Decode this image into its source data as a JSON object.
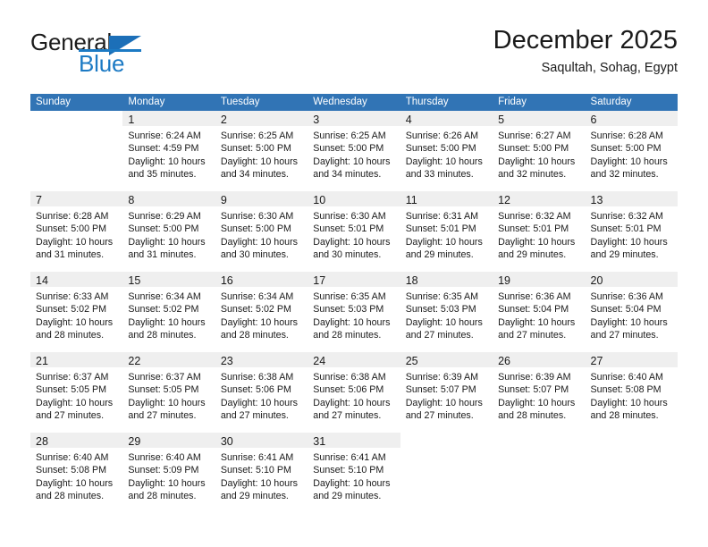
{
  "brand": {
    "name_part1": "General",
    "name_part2": "Blue",
    "logo_icon": "triangle-logo-icon",
    "accent_color": "#1c7ac4"
  },
  "header": {
    "title": "December 2025",
    "subtitle": "Saqultah, Sohag, Egypt"
  },
  "calendar": {
    "header_background": "#3174b5",
    "daynum_band_background": "#efefef",
    "week_rule_color": "#2a6db0",
    "weekdays": [
      "Sunday",
      "Monday",
      "Tuesday",
      "Wednesday",
      "Thursday",
      "Friday",
      "Saturday"
    ],
    "weeks": [
      [
        {
          "day": "",
          "lines": []
        },
        {
          "day": "1",
          "lines": [
            "Sunrise: 6:24 AM",
            "Sunset: 4:59 PM",
            "Daylight: 10 hours",
            "and 35 minutes."
          ]
        },
        {
          "day": "2",
          "lines": [
            "Sunrise: 6:25 AM",
            "Sunset: 5:00 PM",
            "Daylight: 10 hours",
            "and 34 minutes."
          ]
        },
        {
          "day": "3",
          "lines": [
            "Sunrise: 6:25 AM",
            "Sunset: 5:00 PM",
            "Daylight: 10 hours",
            "and 34 minutes."
          ]
        },
        {
          "day": "4",
          "lines": [
            "Sunrise: 6:26 AM",
            "Sunset: 5:00 PM",
            "Daylight: 10 hours",
            "and 33 minutes."
          ]
        },
        {
          "day": "5",
          "lines": [
            "Sunrise: 6:27 AM",
            "Sunset: 5:00 PM",
            "Daylight: 10 hours",
            "and 32 minutes."
          ]
        },
        {
          "day": "6",
          "lines": [
            "Sunrise: 6:28 AM",
            "Sunset: 5:00 PM",
            "Daylight: 10 hours",
            "and 32 minutes."
          ]
        }
      ],
      [
        {
          "day": "7",
          "lines": [
            "Sunrise: 6:28 AM",
            "Sunset: 5:00 PM",
            "Daylight: 10 hours",
            "and 31 minutes."
          ]
        },
        {
          "day": "8",
          "lines": [
            "Sunrise: 6:29 AM",
            "Sunset: 5:00 PM",
            "Daylight: 10 hours",
            "and 31 minutes."
          ]
        },
        {
          "day": "9",
          "lines": [
            "Sunrise: 6:30 AM",
            "Sunset: 5:00 PM",
            "Daylight: 10 hours",
            "and 30 minutes."
          ]
        },
        {
          "day": "10",
          "lines": [
            "Sunrise: 6:30 AM",
            "Sunset: 5:01 PM",
            "Daylight: 10 hours",
            "and 30 minutes."
          ]
        },
        {
          "day": "11",
          "lines": [
            "Sunrise: 6:31 AM",
            "Sunset: 5:01 PM",
            "Daylight: 10 hours",
            "and 29 minutes."
          ]
        },
        {
          "day": "12",
          "lines": [
            "Sunrise: 6:32 AM",
            "Sunset: 5:01 PM",
            "Daylight: 10 hours",
            "and 29 minutes."
          ]
        },
        {
          "day": "13",
          "lines": [
            "Sunrise: 6:32 AM",
            "Sunset: 5:01 PM",
            "Daylight: 10 hours",
            "and 29 minutes."
          ]
        }
      ],
      [
        {
          "day": "14",
          "lines": [
            "Sunrise: 6:33 AM",
            "Sunset: 5:02 PM",
            "Daylight: 10 hours",
            "and 28 minutes."
          ]
        },
        {
          "day": "15",
          "lines": [
            "Sunrise: 6:34 AM",
            "Sunset: 5:02 PM",
            "Daylight: 10 hours",
            "and 28 minutes."
          ]
        },
        {
          "day": "16",
          "lines": [
            "Sunrise: 6:34 AM",
            "Sunset: 5:02 PM",
            "Daylight: 10 hours",
            "and 28 minutes."
          ]
        },
        {
          "day": "17",
          "lines": [
            "Sunrise: 6:35 AM",
            "Sunset: 5:03 PM",
            "Daylight: 10 hours",
            "and 28 minutes."
          ]
        },
        {
          "day": "18",
          "lines": [
            "Sunrise: 6:35 AM",
            "Sunset: 5:03 PM",
            "Daylight: 10 hours",
            "and 27 minutes."
          ]
        },
        {
          "day": "19",
          "lines": [
            "Sunrise: 6:36 AM",
            "Sunset: 5:04 PM",
            "Daylight: 10 hours",
            "and 27 minutes."
          ]
        },
        {
          "day": "20",
          "lines": [
            "Sunrise: 6:36 AM",
            "Sunset: 5:04 PM",
            "Daylight: 10 hours",
            "and 27 minutes."
          ]
        }
      ],
      [
        {
          "day": "21",
          "lines": [
            "Sunrise: 6:37 AM",
            "Sunset: 5:05 PM",
            "Daylight: 10 hours",
            "and 27 minutes."
          ]
        },
        {
          "day": "22",
          "lines": [
            "Sunrise: 6:37 AM",
            "Sunset: 5:05 PM",
            "Daylight: 10 hours",
            "and 27 minutes."
          ]
        },
        {
          "day": "23",
          "lines": [
            "Sunrise: 6:38 AM",
            "Sunset: 5:06 PM",
            "Daylight: 10 hours",
            "and 27 minutes."
          ]
        },
        {
          "day": "24",
          "lines": [
            "Sunrise: 6:38 AM",
            "Sunset: 5:06 PM",
            "Daylight: 10 hours",
            "and 27 minutes."
          ]
        },
        {
          "day": "25",
          "lines": [
            "Sunrise: 6:39 AM",
            "Sunset: 5:07 PM",
            "Daylight: 10 hours",
            "and 27 minutes."
          ]
        },
        {
          "day": "26",
          "lines": [
            "Sunrise: 6:39 AM",
            "Sunset: 5:07 PM",
            "Daylight: 10 hours",
            "and 28 minutes."
          ]
        },
        {
          "day": "27",
          "lines": [
            "Sunrise: 6:40 AM",
            "Sunset: 5:08 PM",
            "Daylight: 10 hours",
            "and 28 minutes."
          ]
        }
      ],
      [
        {
          "day": "28",
          "lines": [
            "Sunrise: 6:40 AM",
            "Sunset: 5:08 PM",
            "Daylight: 10 hours",
            "and 28 minutes."
          ]
        },
        {
          "day": "29",
          "lines": [
            "Sunrise: 6:40 AM",
            "Sunset: 5:09 PM",
            "Daylight: 10 hours",
            "and 28 minutes."
          ]
        },
        {
          "day": "30",
          "lines": [
            "Sunrise: 6:41 AM",
            "Sunset: 5:10 PM",
            "Daylight: 10 hours",
            "and 29 minutes."
          ]
        },
        {
          "day": "31",
          "lines": [
            "Sunrise: 6:41 AM",
            "Sunset: 5:10 PM",
            "Daylight: 10 hours",
            "and 29 minutes."
          ]
        },
        {
          "day": "",
          "lines": []
        },
        {
          "day": "",
          "lines": []
        },
        {
          "day": "",
          "lines": []
        }
      ]
    ]
  }
}
